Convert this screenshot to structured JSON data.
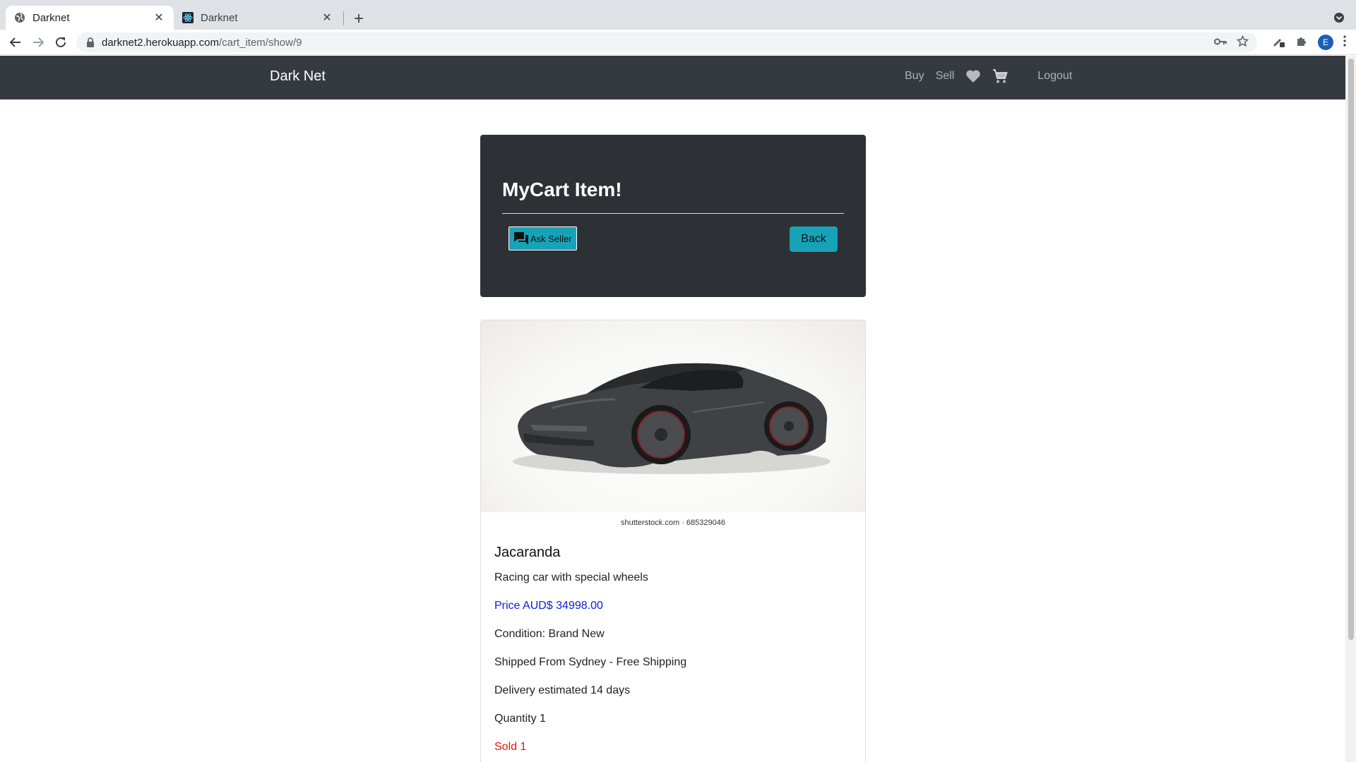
{
  "browser": {
    "tabs": [
      {
        "title": "Darknet",
        "active": true
      },
      {
        "title": "Darknet",
        "active": false
      }
    ],
    "url_host": "darknet2.herokuapp.com",
    "url_path": "/cart_item/show/9",
    "profile_initial": "E"
  },
  "navbar": {
    "brand": "Dark Net",
    "links": {
      "buy": "Buy",
      "sell": "Sell",
      "logout": "Logout"
    }
  },
  "header": {
    "title": "MyCart Item!",
    "ask_seller_label": "Ask Seller",
    "back_label": "Back"
  },
  "product": {
    "image_caption": "shutterstock.com · 685329046",
    "name": "Jacaranda",
    "description": "Racing car with special wheels",
    "price": "Price AUD$ 34998.00",
    "condition": "Condition: Brand New",
    "shipping": "Shipped From Sydney - Free Shipping",
    "delivery": "Delivery estimated 14 days",
    "quantity": "Quantity 1",
    "sold": "Sold 1"
  },
  "colors": {
    "navbar": "#343a40",
    "jumbotron": "#2d3034",
    "button": "#17a2b8",
    "price": "#0b20d9",
    "sold": "#e8130b"
  }
}
